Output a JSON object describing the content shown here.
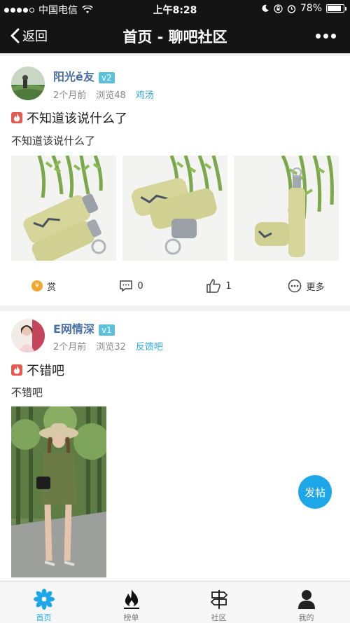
{
  "status_bar": {
    "carrier": "中国电信",
    "time": "上午8:28",
    "battery": "78%"
  },
  "nav": {
    "back_label": "返回",
    "title": "首页 - 聊吧社区"
  },
  "posts": [
    {
      "username": "阳光ě友",
      "level": "v2",
      "time_ago": "2个月前",
      "views": "浏览48",
      "tag": "鸡汤",
      "title": "不知道该说什么了",
      "body": "不知道该说什么了",
      "actions": {
        "reward": "赏",
        "comments": "0",
        "likes": "1",
        "more": "更多"
      }
    },
    {
      "username": "E网情深",
      "level": "v1",
      "time_ago": "2个月前",
      "views": "浏览32",
      "tag": "反馈吧",
      "title": "不错吧",
      "body": "不错吧"
    }
  ],
  "fab_label": "发帖",
  "tabbar": [
    {
      "label": "首页",
      "icon": "flower-icon",
      "active": true
    },
    {
      "label": "榜单",
      "icon": "fire-icon",
      "active": false
    },
    {
      "label": "社区",
      "icon": "signpost-icon",
      "active": false
    },
    {
      "label": "我的",
      "icon": "person-icon",
      "active": false
    }
  ],
  "colors": {
    "accent": "#1ea7e8",
    "header_bg": "#141414",
    "username": "#4a6fa5",
    "tag": "#2ea8e0"
  }
}
